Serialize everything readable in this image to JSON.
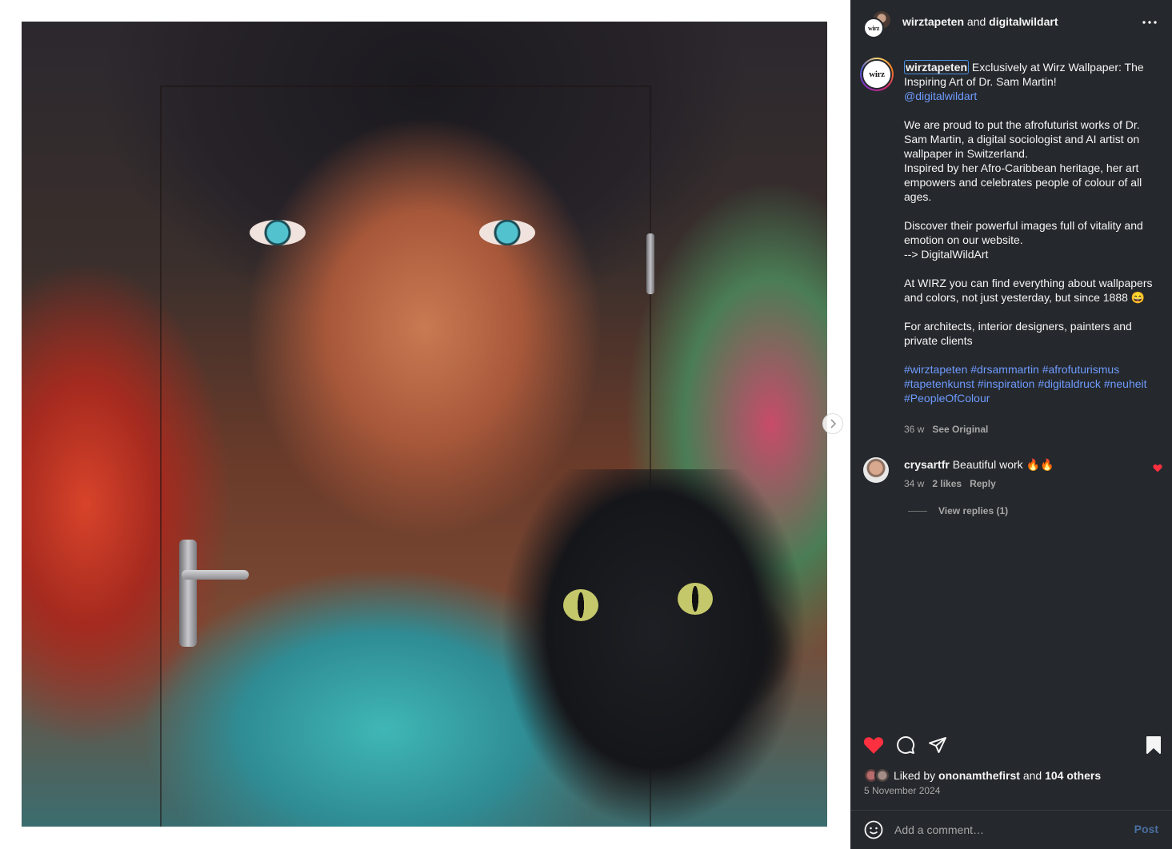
{
  "header": {
    "user_a": "wirztapeten",
    "connector": " and ",
    "user_b": "digitalwildart",
    "more_icon": "more-horizontal-icon"
  },
  "logo_text": "wirz",
  "caption": {
    "username": "wirztapeten",
    "line1": "Exclusively at Wirz Wallpaper: The Inspiring Art of Dr. Sam Martin!",
    "mention": "@digitalwildart",
    "body": "We are proud to put the afrofuturist works of Dr. Sam Martin, a digital sociologist and AI artist on wallpaper in Switzerland.\nInspired by her Afro-Caribbean heritage, her art empowers and celebrates people of colour of all ages.\n\nDiscover their powerful images full of vitality and emotion on our website.\n--> DigitalWildArt\n\nAt WIRZ you can find everything about wallpapers and colors, not just yesterday, but since 1888 😄\n\nFor architects, interior designers, painters and private clients",
    "hashtags": "#wirztapeten #drsammartin #afrofuturismus #tapetenkunst #inspiration #digitaldruck #neuheit #PeopleOfColour",
    "time": "36 w",
    "see_original": "See Original"
  },
  "comment": {
    "username": "crysartfr",
    "text": "Beautiful work 🔥🔥",
    "time": "34 w",
    "likes": "2 likes",
    "reply": "Reply",
    "view_replies": "View replies (1)"
  },
  "likes": {
    "prefix": "Liked by ",
    "user": "ononamthefirst",
    "middle": " and ",
    "others": "104 others"
  },
  "date": "5 November 2024",
  "comment_box": {
    "placeholder": "Add a comment…",
    "post": "Post"
  },
  "colors": {
    "panel_bg": "#25282c",
    "link": "#6e9bff",
    "like_red": "#ff3040",
    "muted": "#a8a8a8"
  }
}
